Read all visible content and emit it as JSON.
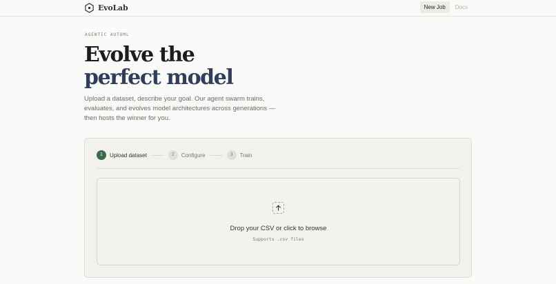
{
  "nav": {
    "brand": "EvoLab",
    "links": [
      {
        "label": "New Job",
        "active": true
      },
      {
        "label": "Docs",
        "active": false
      }
    ]
  },
  "hero": {
    "eyebrow": "AGENTIC AUTOML",
    "title_line1": "Evolve the",
    "title_line2": "perfect model",
    "subtitle": "Upload a dataset, describe your goal. Our agent swarm trains, evaluates, and evolves model architectures across generations — then hosts the winner for you."
  },
  "stepper": {
    "steps": [
      {
        "number": "1",
        "label": "Upload dataset",
        "active": true
      },
      {
        "number": "2",
        "label": "Configure",
        "active": false
      },
      {
        "number": "3",
        "label": "Train",
        "active": false
      }
    ]
  },
  "dropzone": {
    "icon": "upload-arrow-icon",
    "title": "Drop your CSV or click to browse",
    "subtitle": "Supports .csv files"
  },
  "colors": {
    "accent_green": "#3b6b49",
    "title_navy": "#2f3d5e",
    "background": "#fafaf8"
  }
}
